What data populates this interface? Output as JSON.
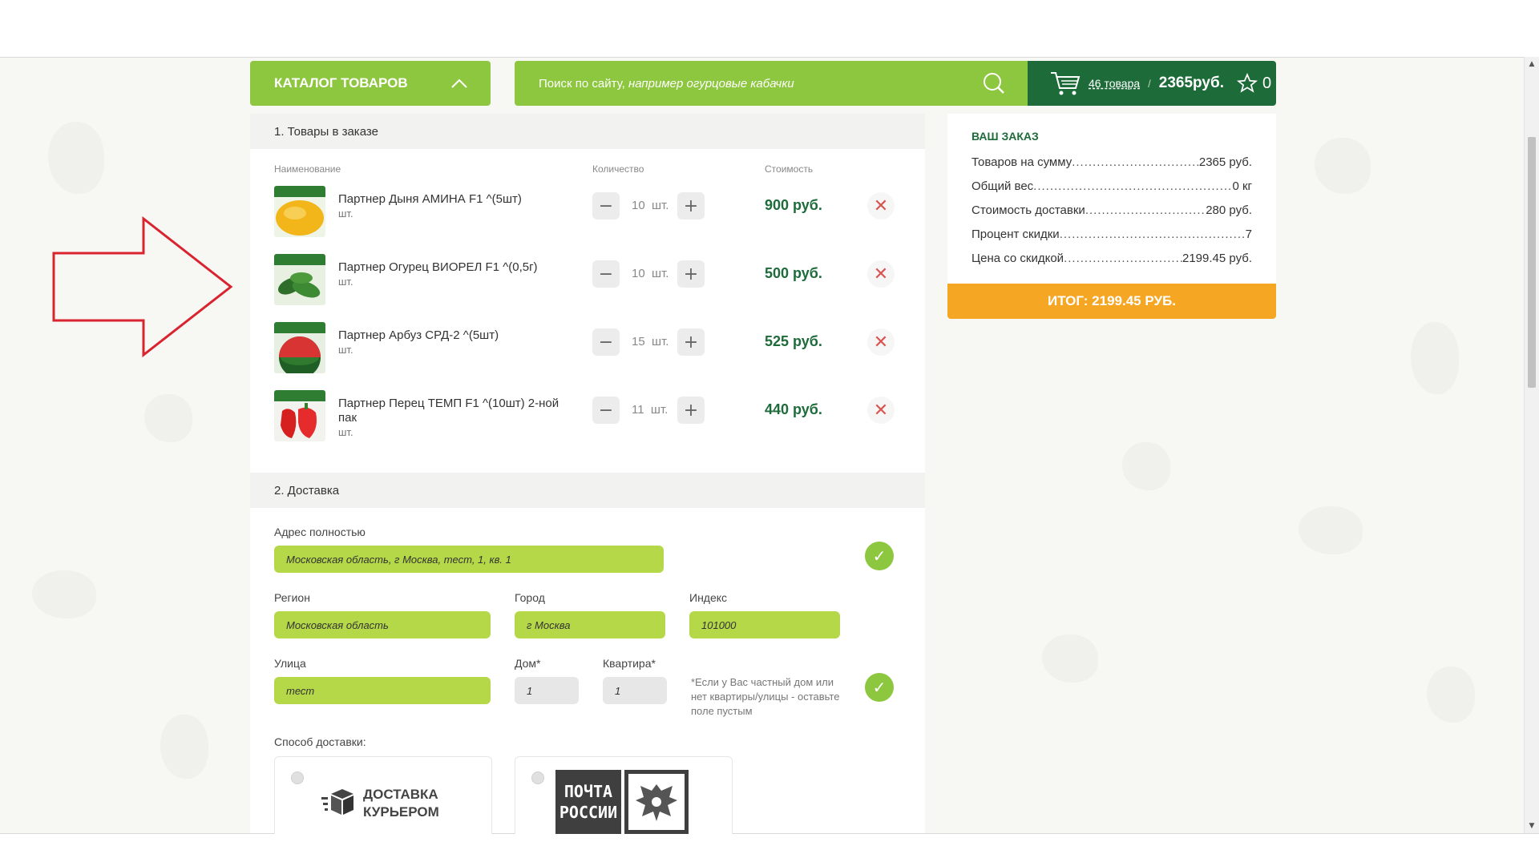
{
  "header": {
    "catalog_label": "КАТАЛОГ ТОВАРОВ",
    "search_placeholder_main": "Поиск по сайту,",
    "search_placeholder_example": "например огурцовые кабачки",
    "cart_count": "46 товара",
    "cart_sep": "/",
    "cart_sum": "2365руб.",
    "favorites_count": "0"
  },
  "order": {
    "section_title": "1. Товары в заказе",
    "col_name": "Наименование",
    "col_qty": "Количество",
    "col_cost": "Стоимость",
    "items": [
      {
        "name": "Партнер Дыня АМИНА F1 ^(5шт)",
        "unit": "шт.",
        "qty": "10",
        "qty_unit": "шт.",
        "price": "900 руб."
      },
      {
        "name": "Партнер Огурец ВИОРЕЛ F1 ^(0,5г)",
        "unit": "шт.",
        "qty": "10",
        "qty_unit": "шт.",
        "price": "500 руб."
      },
      {
        "name": "Партнер Арбуз СРД-2 ^(5шт)",
        "unit": "шт.",
        "qty": "15",
        "qty_unit": "шт.",
        "price": "525 руб."
      },
      {
        "name": "Партнер Перец ТЕМП F1 ^(10шт) 2-ной пак",
        "unit": "шт.",
        "qty": "11",
        "qty_unit": "шт.",
        "price": "440 руб."
      }
    ]
  },
  "delivery": {
    "section_title": "2. Доставка",
    "address_label": "Адрес полностью",
    "address_value": "Московская область, г Москва, тест, 1, кв. 1",
    "region_label": "Регион",
    "region_value": "Московская область",
    "city_label": "Город",
    "city_value": "г Москва",
    "index_label": "Индекс",
    "index_value": "101000",
    "street_label": "Улица",
    "street_value": "тест",
    "house_label": "Дом*",
    "house_value": "1",
    "flat_label": "Квартира*",
    "flat_value": "1",
    "hint": "*Если у Вас частный дом или нет квартиры/улицы - оставьте поле пустым",
    "method_label": "Способ доставки:",
    "courier_line1": "ДОСТАВКА",
    "courier_line2": "КУРЬЕРОМ",
    "post_line1": "ПОЧТА",
    "post_line2": "РОССИИ"
  },
  "summary": {
    "title": "ВАШ ЗАКАЗ",
    "rows": [
      {
        "label": "Товаров на сумму",
        "value": "2365 руб."
      },
      {
        "label": "Общий вес",
        "value": "0 кг"
      },
      {
        "label": "Стоимость доставки",
        "value": "280 руб."
      },
      {
        "label": "Процент скидки",
        "value": "7"
      },
      {
        "label": "Цена со скидкой",
        "value": "2199.45 руб."
      }
    ],
    "total_label": "ИТОГ: 2199.45 РУБ."
  },
  "colors": {
    "brand_green": "#8dc63f",
    "dark_green": "#1e6b3a",
    "field_green": "#b5d848",
    "total_orange": "#f5a623",
    "delete_red": "#d9534f",
    "annotation_arrow": "#d9232e"
  }
}
